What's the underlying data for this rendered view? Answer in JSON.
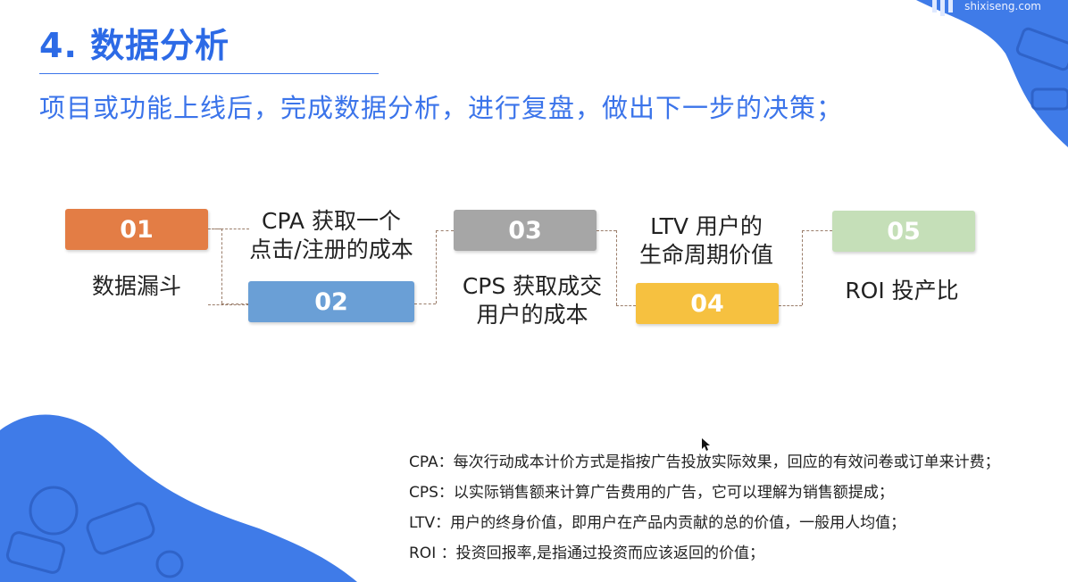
{
  "slide": {
    "title": "4. 数据分析",
    "subtitle": "项目或功能上线后，完成数据分析，进行复盘，做出下一步的决策；",
    "brand": "shixiseng.com"
  },
  "steps": [
    {
      "number": "01",
      "label": "数据漏斗",
      "color": "#e37d45"
    },
    {
      "number": "02",
      "label_lines": [
        "CPA 获取一个",
        "点击/注册的成本"
      ],
      "color": "#6a9fd6"
    },
    {
      "number": "03",
      "label_lines": [
        "CPS 获取成交",
        "用户的成本"
      ],
      "color": "#a6a6a6"
    },
    {
      "number": "04",
      "label_lines": [
        "LTV 用户的",
        "生命周期价值"
      ],
      "color": "#f6c140"
    },
    {
      "number": "05",
      "label": "ROI 投产比",
      "color": "#c5dfb8"
    }
  ],
  "definitions": [
    {
      "term": "CPA：",
      "text": "每次行动成本计价方式是指按广告投放实际效果，回应的有效问卷或订单来计费；"
    },
    {
      "term": "CPS：",
      "text": "以实际销售额来计算广告费用的广告，它可以理解为销售额提成；"
    },
    {
      "term": "LTV：",
      "text": "用户的终身价值，即用户在产品内贡献的总的价值，一般用人均值；"
    },
    {
      "term": "ROI ：",
      "text": "投资回报率,是指通过投资而应该返回的价值；"
    }
  ],
  "colors": {
    "accent": "#2c6ae6",
    "decoration": "#3f7be8"
  }
}
